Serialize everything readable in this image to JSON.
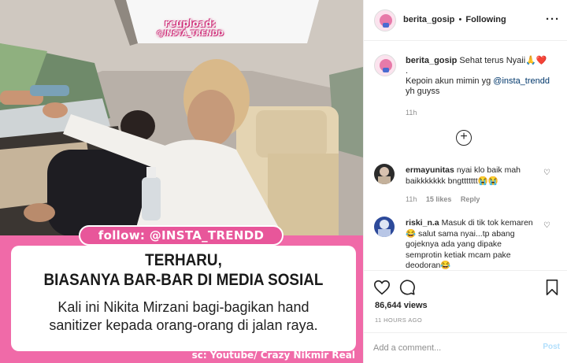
{
  "media": {
    "watermark_line1": "reupload:",
    "watermark_line2": "@INSTA_TRENDD",
    "follow_banner": "follow: @INSTA_TRENDD",
    "headline_line1": "TERHARU,",
    "headline_line2": "BIASANYA BAR-BAR DI MEDIA SOSIAL",
    "subtext_line1": "Kali ini Nikita Mirzani bagi-bagikan hand",
    "subtext_line2": "sanitizer kepada orang-orang di jalan raya.",
    "source": "sc: Youtube/ Crazy Nikmir Real"
  },
  "header": {
    "username": "berita_gosip",
    "separator": "•",
    "follow_state": "Following",
    "more_icon": "more-horizontal-icon"
  },
  "caption": {
    "username": "berita_gosip",
    "line1": "Sehat terus Nyaii🙏❤️",
    "dot": ".",
    "line3_prefix": "Kepoin akun mimin yg ",
    "mention": "@insta_trendd",
    "line4": "yh guyss",
    "time": "11h"
  },
  "comments": [
    {
      "username": "ermayunitas",
      "text": "nyai klo baik mah baikkkkkkk bngttttttt😭😭",
      "time": "11h",
      "likes": "15 likes",
      "reply": "Reply"
    },
    {
      "username": "riski_n.a",
      "text": "Masuk di tik tok kemaren😂 salut sama nyai...tp abang gojeknya ada yang dipake semprotin ketiak mcam pake deodoran😂",
      "time": "",
      "likes": "",
      "reply": ""
    }
  ],
  "actions": {
    "like_icon": "heart-icon",
    "comment_icon": "comment-icon",
    "save_icon": "bookmark-icon",
    "likes_count": "86,644 views",
    "posted_time": "11 HOURS AGO"
  },
  "add_comment": {
    "placeholder": "Add a comment...",
    "post_label": "Post"
  },
  "colors": {
    "pink_band": "#f06aa8",
    "follow_pill": "#e8569a",
    "mention": "#00376b",
    "post_button": "#b2dffc"
  }
}
